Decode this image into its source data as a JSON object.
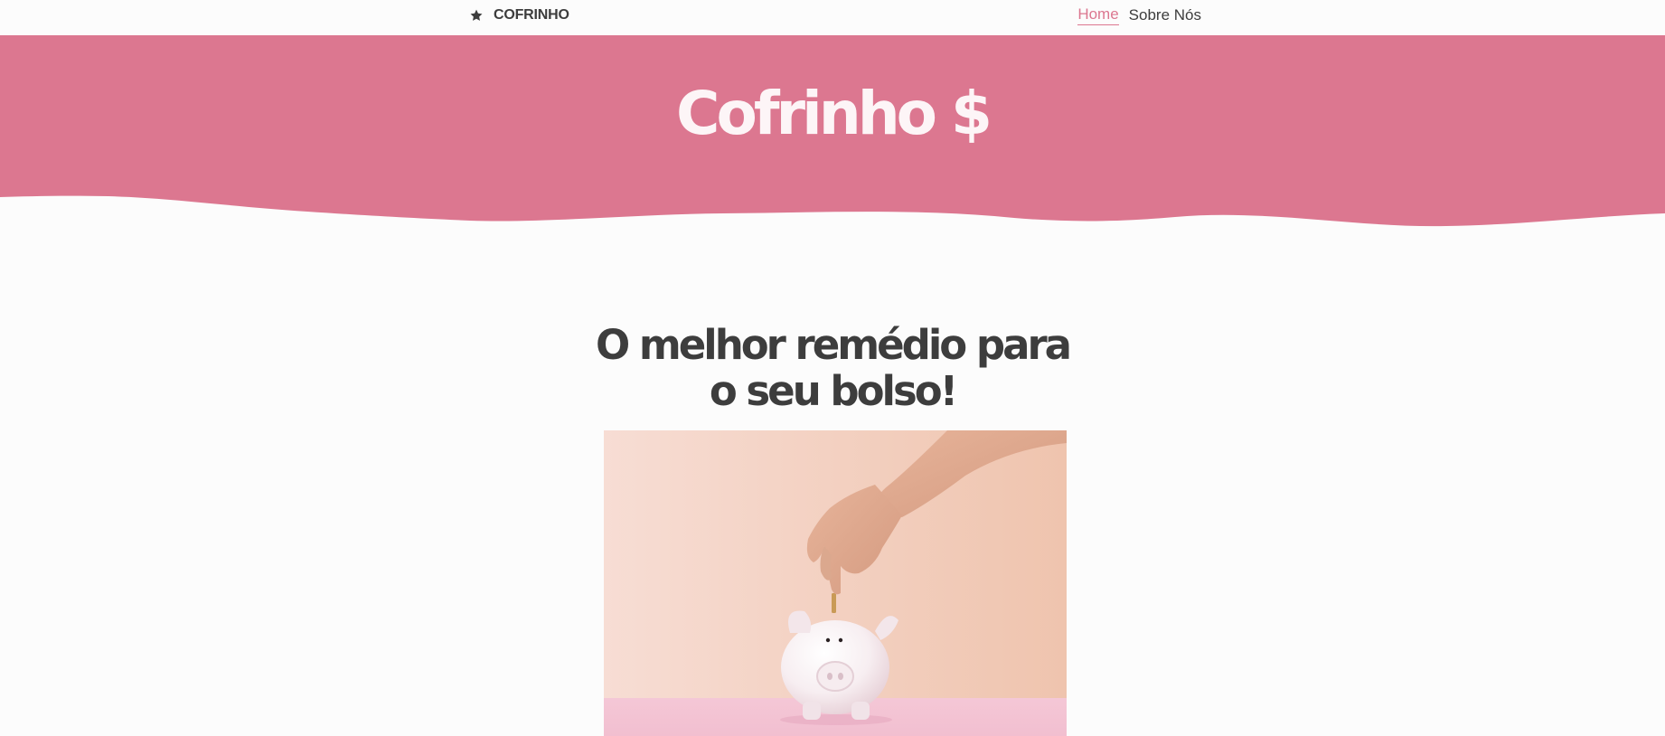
{
  "nav": {
    "brand": "COFRINHO",
    "brand_icon": "star-icon",
    "links": [
      {
        "label": "Home",
        "active": true
      },
      {
        "label": "Sobre Nós",
        "active": false
      }
    ]
  },
  "hero": {
    "title": "Cofrinho $",
    "background_color": "#dc7790"
  },
  "main": {
    "headline_line1": "O melhor remédio para",
    "headline_line2": "o seu bolso!",
    "image_subject": "hand dropping a coin into a white piggy bank on a peach background"
  },
  "colors": {
    "accent": "#dc7790",
    "text": "#3d3d3d",
    "background": "#fcfcfc"
  }
}
